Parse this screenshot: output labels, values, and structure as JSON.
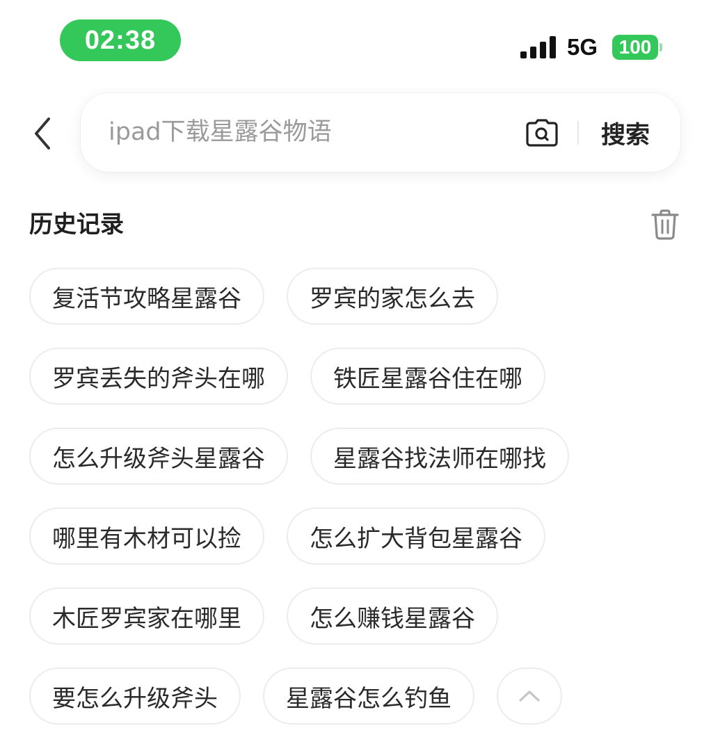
{
  "status_bar": {
    "time": "02:38",
    "network": "5G",
    "battery": "100"
  },
  "search": {
    "placeholder": "ipad下载星露谷物语",
    "submit_label": "搜索"
  },
  "history": {
    "title": "历史记录",
    "items": [
      "复活节攻略星露谷",
      "罗宾的家怎么去",
      "罗宾丢失的斧头在哪",
      "铁匠星露谷住在哪",
      "怎么升级斧头星露谷",
      "星露谷找法师在哪找",
      "哪里有木材可以捡",
      "怎么扩大背包星露谷",
      "木匠罗宾家在哪里",
      "怎么赚钱星露谷",
      "要怎么升级斧头",
      "星露谷怎么钓鱼"
    ]
  },
  "icons": {
    "back": "chevron-left-icon",
    "camera": "camera-search-icon",
    "delete": "trash-icon",
    "collapse": "chevron-up-icon",
    "signal": "signal-bars-icon"
  },
  "colors": {
    "accent": "#34c759",
    "chip_border": "#ececec",
    "placeholder": "#9a9a9a",
    "text": "#1f1f1f"
  }
}
